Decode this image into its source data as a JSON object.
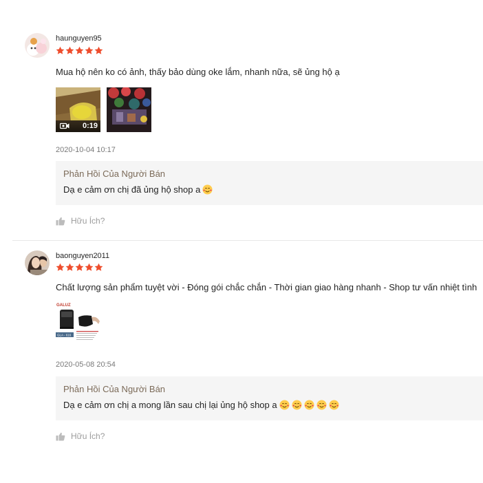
{
  "reviews": [
    {
      "username": "haunguyen95",
      "rating": 5,
      "comment": "Mua hộ nên ko có ảnh, thấy bảo dùng oke lắm, nhanh nữa, sẽ ủng hộ ạ",
      "media": [
        {
          "type": "video",
          "duration": "0:19",
          "icon": "video-camera-icon"
        },
        {
          "type": "image"
        }
      ],
      "date": "2020-10-04 10:17",
      "seller_reply": {
        "title": "Phản Hồi Của Người Bán",
        "text": "Dạ e cảm ơn chị đã ủng hộ shop a",
        "emoji_count": 1
      },
      "helpful_label": "Hữu Ích?"
    },
    {
      "username": "baonguyen2011",
      "rating": 5,
      "comment": "Chất lượng sản phẩm tuyệt vời - Đóng gói chắc chắn - Thời gian giao hàng nhanh - Shop tư vấn nhiệt tình",
      "media": [
        {
          "type": "image",
          "brand_label": "GALUZ",
          "model_label": "GLA - 616"
        }
      ],
      "date": "2020-05-08 20:54",
      "seller_reply": {
        "title": "Phản Hồi Của Người Bán",
        "text": "Dạ e cảm ơn chị a mong lần sau chị lại ủng hộ shop a",
        "emoji_count": 5
      },
      "helpful_label": "Hữu Ích?"
    }
  ],
  "colors": {
    "star": "#ee4d2d",
    "reply_bg": "#f5f5f5",
    "muted": "#8a8a8a"
  },
  "icons": {
    "star": "star-icon",
    "thumbs_up": "thumbs-up-icon",
    "emoji": "smiling-face-with-hearts-icon"
  }
}
